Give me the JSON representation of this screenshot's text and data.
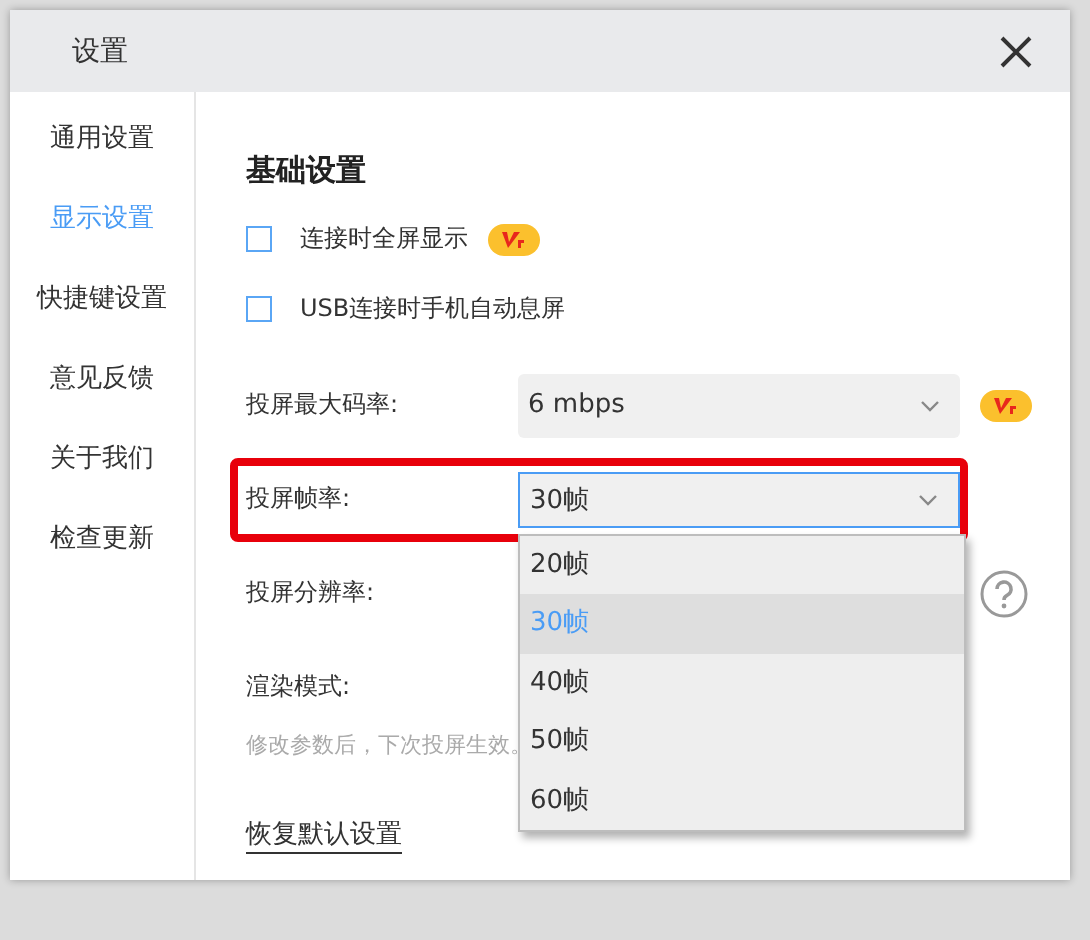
{
  "window": {
    "title": "设置"
  },
  "sidebar": {
    "items": [
      {
        "label": "通用设置",
        "selected": false
      },
      {
        "label": "显示设置",
        "selected": true
      },
      {
        "label": "快捷键设置",
        "selected": false
      },
      {
        "label": "意见反馈",
        "selected": false
      },
      {
        "label": "关于我们",
        "selected": false
      },
      {
        "label": "检查更新",
        "selected": false
      }
    ]
  },
  "section_title": "基础设置",
  "options": [
    {
      "kind": "checkbox",
      "label": "连接时全屏显示",
      "checked": false,
      "vip": true
    },
    {
      "kind": "checkbox",
      "label": "USB连接时手机自动息屏",
      "checked": false
    },
    {
      "kind": "select",
      "label": "投屏最大码率:",
      "value": "6 mbps",
      "vip": true
    },
    {
      "kind": "select",
      "label": "投屏帧率:",
      "value": "30帧",
      "highlighted": true,
      "open": true,
      "menu": [
        {
          "label": "20帧",
          "selected": false
        },
        {
          "label": "30帧",
          "selected": true
        },
        {
          "label": "40帧",
          "selected": false
        },
        {
          "label": "50帧",
          "selected": false
        },
        {
          "label": "60帧",
          "selected": false
        }
      ]
    },
    {
      "kind": "label",
      "label": "投屏分辨率:",
      "help": true
    },
    {
      "kind": "label",
      "label": "渲染模式:"
    }
  ],
  "hint": "修改参数后，下次投屏生效。",
  "reset_link": "恢复默认设置"
}
